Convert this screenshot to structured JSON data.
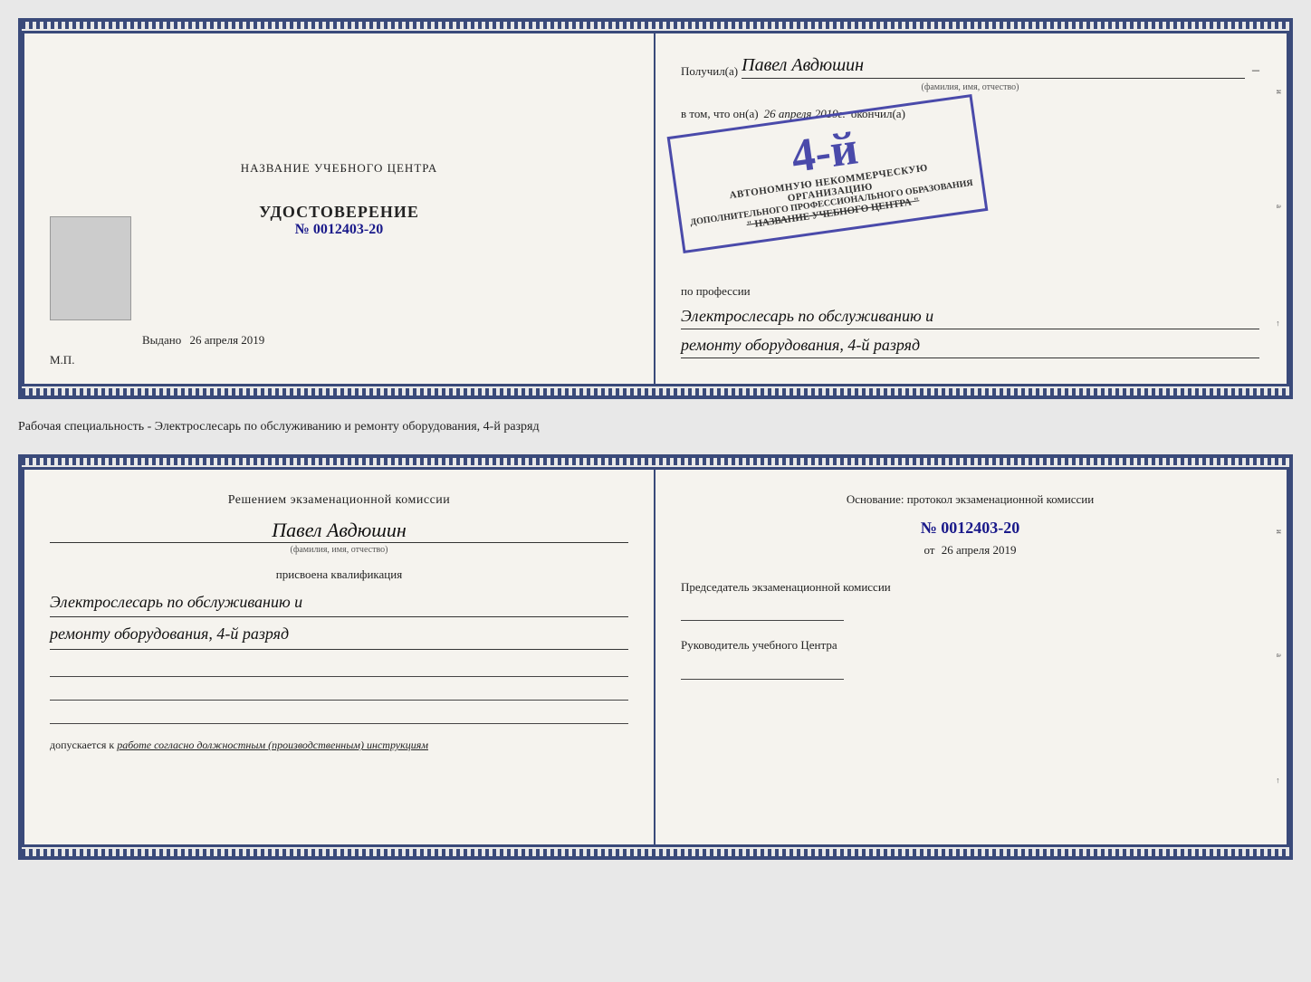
{
  "top_doc": {
    "left": {
      "training_center_label": "НАЗВАНИЕ УЧЕБНОГО ЦЕНТРА",
      "cert_title": "УДОСТОВЕРЕНИЕ",
      "cert_number_label": "№",
      "cert_number": "0012403-20",
      "issued_label": "Выдано",
      "issued_date": "26 апреля 2019",
      "mp_label": "М.П."
    },
    "right": {
      "recipient_prefix": "Получил(а)",
      "recipient_name": "Павел Авдюшин",
      "recipient_dash": "–",
      "fio_label": "(фамилия, имя, отчество)",
      "vtom_label": "в том, что он(а)",
      "vtom_date": "26 апреля 2019г.",
      "finished_label": "окончил(а)",
      "stamp_grade": "4-й",
      "stamp_row1": "АВТОНОМНУЮ НЕКОММЕРЧЕСКУЮ ОРГАНИЗАЦИЮ",
      "stamp_row2": "ДОПОЛНИТЕЛЬНОГО ПРОФЕССИОНАЛЬНОГО ОБРАЗОВАНИЯ",
      "stamp_row3": "\" НАЗВАНИЕ УЧЕБНОГО ЦЕНТРА \"",
      "profession_label": "по профессии",
      "profession_line1": "Электрослесарь по обслуживанию и",
      "profession_line2": "ремонту оборудования, 4-й разряд"
    }
  },
  "middle_text": "Рабочая специальность - Электрослесарь по обслуживанию и ремонту оборудования, 4-й разряд",
  "bottom_doc": {
    "left": {
      "commission_title": "Решением экзаменационной  комиссии",
      "person_name": "Павел Авдюшин",
      "fio_label": "(фамилия, имя, отчество)",
      "qualification_prefix": "присвоена квалификация",
      "qualification_line1": "Электрослесарь по обслуживанию и",
      "qualification_line2": "ремонту оборудования, 4-й разряд",
      "допускается_text": "допускается к",
      "допускается_value": "работе согласно должностным (производственным) инструкциям"
    },
    "right": {
      "osnov_label": "Основание: протокол экзаменационной  комиссии",
      "protocol_number_prefix": "№",
      "protocol_number": "0012403-20",
      "date_prefix": "от",
      "date_value": "26 апреля 2019",
      "chairman_label": "Председатель экзаменационной комиссии",
      "head_label": "Руководитель учебного Центра"
    }
  },
  "right_ticks": {
    "items": [
      "–",
      "–",
      "–",
      "и",
      "а",
      "←",
      "–",
      "–",
      "–",
      "–"
    ]
  }
}
